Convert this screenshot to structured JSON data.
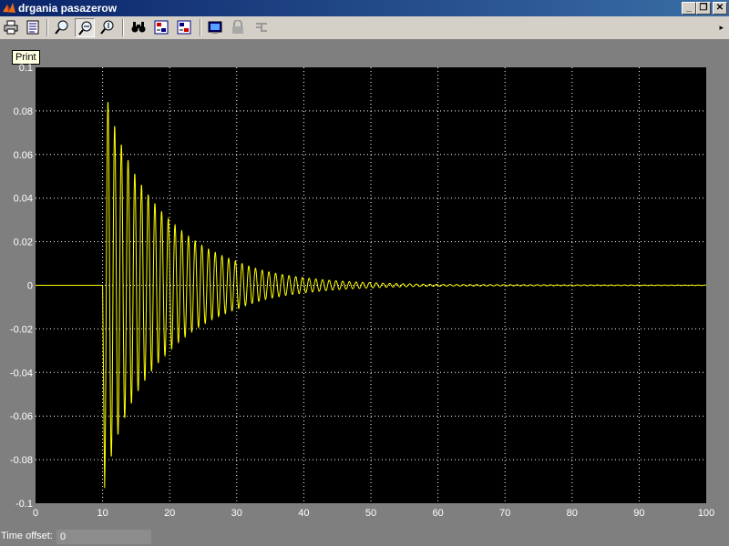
{
  "window": {
    "title": "drgania pasazerow",
    "buttons": {
      "minimize": "_",
      "restore": "❐",
      "close": "✕"
    }
  },
  "toolbar": {
    "buttons": [
      {
        "name": "print-icon"
      },
      {
        "name": "parameters-icon"
      },
      {
        "name": "zoom-icon"
      },
      {
        "name": "zoom-x-icon",
        "pressed": true
      },
      {
        "name": "zoom-y-icon"
      },
      {
        "name": "autoscale-icon"
      },
      {
        "name": "save-axes-icon"
      },
      {
        "name": "restore-axes-icon"
      },
      {
        "name": "floating-scope-icon"
      },
      {
        "name": "lock-icon"
      },
      {
        "name": "signal-selector-icon"
      }
    ],
    "overflow_arrow": "▸"
  },
  "tooltip": {
    "text": "Print"
  },
  "status": {
    "label": "Time offset:",
    "value": "0"
  },
  "colors": {
    "plot_bg": "#000000",
    "trace": "#ffff00",
    "grid": "#ffffff",
    "frame_bg": "#7f7f7f"
  },
  "chart_data": {
    "type": "line",
    "title": "",
    "xlabel": "",
    "ylabel": "",
    "xlim": [
      0,
      100
    ],
    "ylim": [
      -0.1,
      0.1
    ],
    "grid": true,
    "x_ticks": [
      "0",
      "10",
      "20",
      "30",
      "40",
      "50",
      "60",
      "70",
      "80",
      "90",
      "100"
    ],
    "y_ticks": [
      "0.1",
      "0.08",
      "0.06",
      "0.04",
      "0.02",
      "0",
      "-0.02",
      "-0.04",
      "-0.06",
      "-0.08",
      "-0.1"
    ],
    "x_tick_values": [
      0,
      10,
      20,
      30,
      40,
      50,
      60,
      70,
      80,
      90,
      100
    ],
    "y_tick_values": [
      0.1,
      0.08,
      0.06,
      0.04,
      0.02,
      0,
      -0.02,
      -0.04,
      -0.06,
      -0.08,
      -0.1
    ],
    "series": [
      {
        "signal": {
          "baseline_until": 10,
          "first_peak": -0.093,
          "first_peak_time": 10.3,
          "second_peak": 0.082,
          "period": 1.0,
          "envelope_points": [
            [
              10,
              0.093
            ],
            [
              11,
              0.082
            ],
            [
              12,
              0.071
            ],
            [
              13,
              0.063
            ],
            [
              15,
              0.05
            ],
            [
              20,
              0.03
            ],
            [
              25,
              0.018
            ],
            [
              30,
              0.011
            ],
            [
              35,
              0.006
            ],
            [
              40,
              0.0035
            ],
            [
              50,
              0.0012
            ],
            [
              60,
              0.0004
            ],
            [
              100,
              0.0001
            ]
          ]
        }
      }
    ]
  }
}
